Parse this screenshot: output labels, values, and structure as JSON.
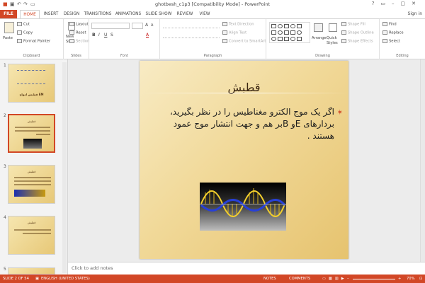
{
  "window": {
    "title": "ghotbesh_c1p3 [Compatibility Mode] - PowerPoint",
    "sign_in": "Sign in"
  },
  "tabs": [
    "FILE",
    "HOME",
    "INSERT",
    "DESIGN",
    "TRANSITIONS",
    "ANIMATIONS",
    "SLIDE SHOW",
    "REVIEW",
    "VIEW"
  ],
  "ribbon": {
    "clipboard": {
      "paste": "Paste",
      "cut": "Cut",
      "copy": "Copy",
      "format_painter": "Format Painter",
      "label": "Clipboard"
    },
    "slides": {
      "new_slide": "New Slide",
      "layout": "Layout",
      "reset": "Reset",
      "section": "Section",
      "label": "Slides"
    },
    "font": {
      "label": "Font",
      "bold": "B",
      "italic": "I",
      "underline": "U",
      "strike": "S",
      "aa_up": "A",
      "aa_down": "A",
      "color": "A"
    },
    "paragraph": {
      "text_direction": "Text Direction",
      "align_text": "Align Text",
      "convert_smartart": "Convert to SmartArt",
      "label": "Paragraph"
    },
    "drawing": {
      "arrange": "Arrange",
      "quick_styles": "Quick Styles",
      "shape_fill": "Shape Fill",
      "shape_outline": "Shape Outline",
      "shape_effects": "Shape Effects",
      "label": "Drawing"
    },
    "editing": {
      "find": "Find",
      "replace": "Replace",
      "select": "Select",
      "label": "Editing"
    }
  },
  "thumbnails": [
    {
      "num": "1",
      "title": "قطبش امواج EM"
    },
    {
      "num": "2",
      "title": "قطبش"
    },
    {
      "num": "3",
      "title": "قطبش"
    },
    {
      "num": "4",
      "title": "قطبش"
    },
    {
      "num": "5",
      "title": ""
    }
  ],
  "slide": {
    "title": "قطبش",
    "body": "اگر یک موج الکترو مغناطیس را در نظر بگیرید، بردارهای  Eو  Bبر هم و جهت انتشار موج عمود هستند ."
  },
  "notes_placeholder": "Click to add notes",
  "status": {
    "slide": "SLIDE 2 OF 54",
    "language": "ENGLISH (UNITED STATES)",
    "notes": "NOTES",
    "comments": "COMMENTS",
    "zoom": "70%"
  },
  "colors": {
    "accent": "#d24726",
    "slide_bg": "#f1d999",
    "title": "#3a2510"
  }
}
